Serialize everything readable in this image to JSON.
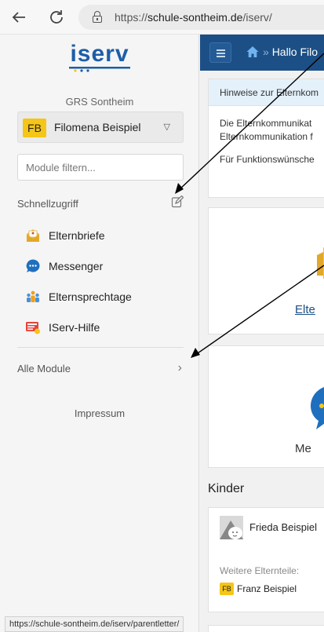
{
  "browser": {
    "url_prefix": "https://",
    "url_domain": "schule-sontheim.de",
    "url_path": "/iserv/"
  },
  "sidebar": {
    "logo_text": "iserv",
    "school": "GRS Sontheim",
    "user": {
      "initials": "FB",
      "name": "Filomena Beispiel"
    },
    "filter_placeholder": "Module filtern...",
    "quick_access_title": "Schnellzugriff",
    "quick_items": [
      {
        "label": "Elternbriefe",
        "icon": "parentletter-icon"
      },
      {
        "label": "Messenger",
        "icon": "messenger-icon"
      },
      {
        "label": "Elternsprechtage",
        "icon": "parent-meeting-icon"
      },
      {
        "label": "IServ-Hilfe",
        "icon": "help-icon"
      }
    ],
    "all_modules": "Alle Module",
    "impressum": "Impressum"
  },
  "status_bar_url": "https://schule-sontheim.de/iserv/parentletter/",
  "main": {
    "breadcrumb_separator": "»",
    "breadcrumb": "Hallo Filo",
    "info_header": "Hinweise zur Elternkom",
    "info_lines": [
      "Die Elternkommunikat",
      "Elternkommunikation f",
      "Für Funktionswünsche"
    ],
    "tile1_label": "Elte",
    "tile2_label": "Me",
    "kinder_title": "Kinder",
    "child_name": "Frieda Beispiel",
    "more_parents_label": "Weitere Elternteile:",
    "parent": {
      "initials": "FB",
      "name": "Franz Beispiel"
    }
  },
  "colors": {
    "nav_blue": "#1c4f85",
    "iserv_blue": "#1d5ea8",
    "avatar_yellow": "#f5c518",
    "annotation_arrow": "#000000"
  }
}
